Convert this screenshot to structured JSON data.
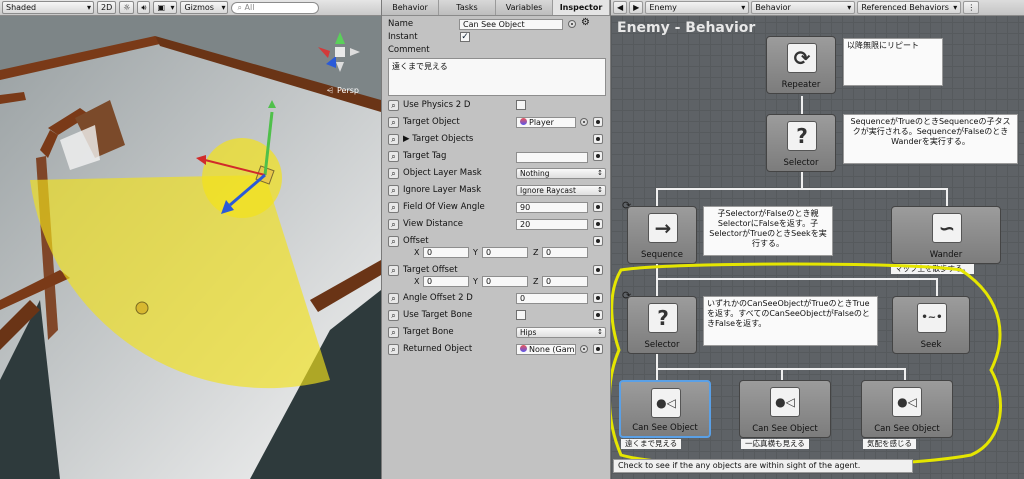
{
  "scene": {
    "toolbar": {
      "shading_mode": "Shaded",
      "mode_2d": "2D",
      "light_icon": "sun-icon",
      "audio_icon": "speaker-icon",
      "image_icon": "image-icon",
      "gizmos": "Gizmos",
      "search_placeholder": "All"
    },
    "persp_label": "Persp"
  },
  "inspector": {
    "tabs": [
      "Behavior",
      "Tasks",
      "Variables",
      "Inspector"
    ],
    "active_tab": "Inspector",
    "name_label": "Name",
    "name_value": "Can See Object",
    "instant_label": "Instant",
    "instant_checked": true,
    "comment_label": "Comment",
    "comment_value": "遠くまで見える",
    "properties": {
      "use_physics_2d": {
        "label": "Use Physics 2 D"
      },
      "target_object": {
        "label": "Target Object",
        "value": "Player"
      },
      "target_objects": {
        "label": "Target Objects"
      },
      "target_tag": {
        "label": "Target Tag"
      },
      "object_layer_mask": {
        "label": "Object Layer Mask",
        "value": "Nothing"
      },
      "ignore_layer_mask": {
        "label": "Ignore Layer Mask",
        "value": "Ignore Raycast"
      },
      "field_of_view_angle": {
        "label": "Field Of View Angle",
        "value": "90"
      },
      "view_distance": {
        "label": "View Distance",
        "value": "20"
      },
      "offset": {
        "label": "Offset",
        "x": "0",
        "y": "0",
        "z": "0"
      },
      "target_offset": {
        "label": "Target Offset",
        "x": "0",
        "y": "0",
        "z": "0"
      },
      "angle_offset_2d": {
        "label": "Angle Offset 2 D",
        "value": "0"
      },
      "use_target_bone": {
        "label": "Use Target Bone"
      },
      "target_bone": {
        "label": "Target Bone",
        "value": "Hips"
      },
      "returned_object": {
        "label": "Returned Object",
        "value": "None (Gam"
      }
    },
    "axis_labels": {
      "x": "X",
      "y": "Y",
      "z": "Z"
    }
  },
  "graph": {
    "toolbar": {
      "prev": "◀",
      "next": "▶",
      "object": "Enemy",
      "behavior": "Behavior",
      "referenced": "Referenced Behaviors"
    },
    "title": "Enemy - Behavior",
    "nodes": {
      "repeater": {
        "label": "Repeater",
        "icon": "⟳",
        "comment": "以降無限にリピート"
      },
      "selector_top": {
        "label": "Selector",
        "icon": "?",
        "comment": "SequenceがTrueのときSequenceの子タスクが実行される。SequenceがFalseのときWanderを実行する。"
      },
      "sequence": {
        "label": "Sequence",
        "icon": "→",
        "comment": "子SelectorがFalseのとき親SelectorにFalseを返す。子SelectorがTrueのときSeekを実行する。"
      },
      "wander": {
        "label": "Wander",
        "icon": "∽",
        "note": "マップ上を散歩する。"
      },
      "selector_mid": {
        "label": "Selector",
        "icon": "?",
        "comment": "いずれかのCanSeeObjectがTrueのときTrueを返す。すべてのCanSeeObjectがFalseのときFalseを返す。"
      },
      "seek": {
        "label": "Seek",
        "icon": "•~•"
      },
      "cso1": {
        "label": "Can See Object",
        "icon": "●◁",
        "note": "遠くまで見える"
      },
      "cso2": {
        "label": "Can See Object",
        "icon": "●◁",
        "note": "一応真横も見える"
      },
      "cso3": {
        "label": "Can See Object",
        "icon": "●◁",
        "note": "気配を感じる"
      }
    },
    "status": "Check to see if the any objects are within sight of the agent.",
    "colors": {
      "highlight": "#e5e600",
      "selected": "#5aa0e6"
    }
  }
}
